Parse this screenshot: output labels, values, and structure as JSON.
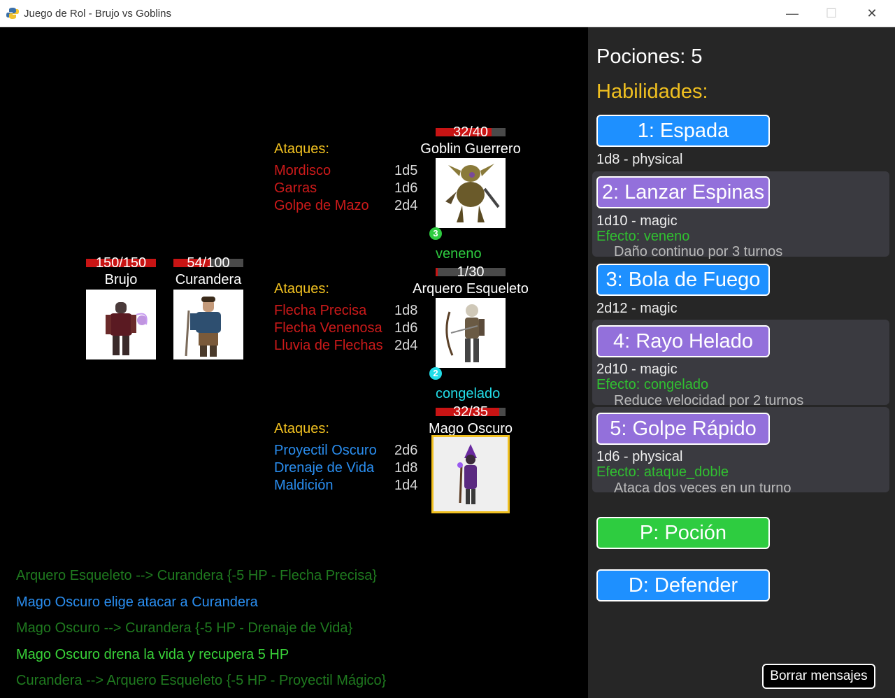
{
  "window": {
    "title": "Juego de Rol - Brujo vs Goblins",
    "minimize": "—",
    "maximize": "☐",
    "close": "✕"
  },
  "party": [
    {
      "name": "Brujo",
      "hp_text": "150/150",
      "hp_fraction": 1.0
    },
    {
      "name": "Curandera",
      "hp_text": "54/100",
      "hp_fraction": 0.54
    }
  ],
  "enemies": [
    {
      "name": "Goblin Guerrero",
      "hp_text": "32/40",
      "hp_fraction": 0.8,
      "attacks_title": "Ataques:",
      "attacks": [
        {
          "name": "Mordisco",
          "dice": "1d5"
        },
        {
          "name": "Garras",
          "dice": "1d6"
        },
        {
          "name": "Golpe de Mazo",
          "dice": "2d4"
        }
      ],
      "attack_color": "#cc1a1a",
      "status": {
        "turns": "3",
        "label": "veneno",
        "color": "#2ecc40"
      }
    },
    {
      "name": "Arquero Esqueleto",
      "hp_text": "1/30",
      "hp_fraction": 0.033,
      "attacks_title": "Ataques:",
      "attacks": [
        {
          "name": "Flecha Precisa",
          "dice": "1d8"
        },
        {
          "name": "Flecha Venenosa",
          "dice": "1d6"
        },
        {
          "name": "Lluvia de Flechas",
          "dice": "2d4"
        }
      ],
      "attack_color": "#cc1a1a",
      "status": {
        "turns": "2",
        "label": "congelado",
        "color": "#22dde8"
      }
    },
    {
      "name": "Mago Oscuro",
      "hp_text": "32/35",
      "hp_fraction": 0.914,
      "attacks_title": "Ataques:",
      "attacks": [
        {
          "name": "Proyectil Oscuro",
          "dice": "2d6"
        },
        {
          "name": "Drenaje de Vida",
          "dice": "1d8"
        },
        {
          "name": "Maldición",
          "dice": "1d4"
        }
      ],
      "attack_color": "#2a8ef0",
      "selected": true
    }
  ],
  "log": [
    {
      "text": "Arquero Esqueleto --> Curandera {-5 HP - Flecha Precisa}",
      "color": "#1f7a1f"
    },
    {
      "text": "Mago Oscuro elige atacar a Curandera",
      "color": "#2a8ef0"
    },
    {
      "text": "Mago Oscuro --> Curandera {-5 HP - Drenaje de Vida}",
      "color": "#1f7a1f"
    },
    {
      "text": "Mago Oscuro drena la vida y recupera 5 HP",
      "color": "#39d339"
    },
    {
      "text": "Curandera --> Arquero Esqueleto {-5 HP - Proyectil Mágico}",
      "color": "#1f7a1f"
    }
  ],
  "panel": {
    "potions": "Pociones: 5",
    "skills_title": "Habilidades:",
    "skills": [
      {
        "label": "1: Espada",
        "meta": "1d8 - physical",
        "color": "#1e90ff"
      },
      {
        "label": "2: Lanzar Espinas",
        "meta": "1d10 - magic",
        "effect": "Efecto: veneno",
        "desc": "Daño continuo por 3 turnos",
        "color": "#9370db"
      },
      {
        "label": "3: Bola de Fuego",
        "meta": "2d12 - magic",
        "color": "#1e90ff"
      },
      {
        "label": "4: Rayo Helado",
        "meta": "2d10 - magic",
        "effect": "Efecto: congelado",
        "desc": "Reduce velocidad por 2 turnos",
        "color": "#9370db"
      },
      {
        "label": "5: Golpe Rápido",
        "meta": "1d6 - physical",
        "effect": "Efecto: ataque_doble",
        "desc": "Ataca dos veces en un turno",
        "color": "#9370db"
      }
    ],
    "potion_button": "P: Poción",
    "defend_button": "D: Defender",
    "clear_button": "Borrar mensajes"
  }
}
